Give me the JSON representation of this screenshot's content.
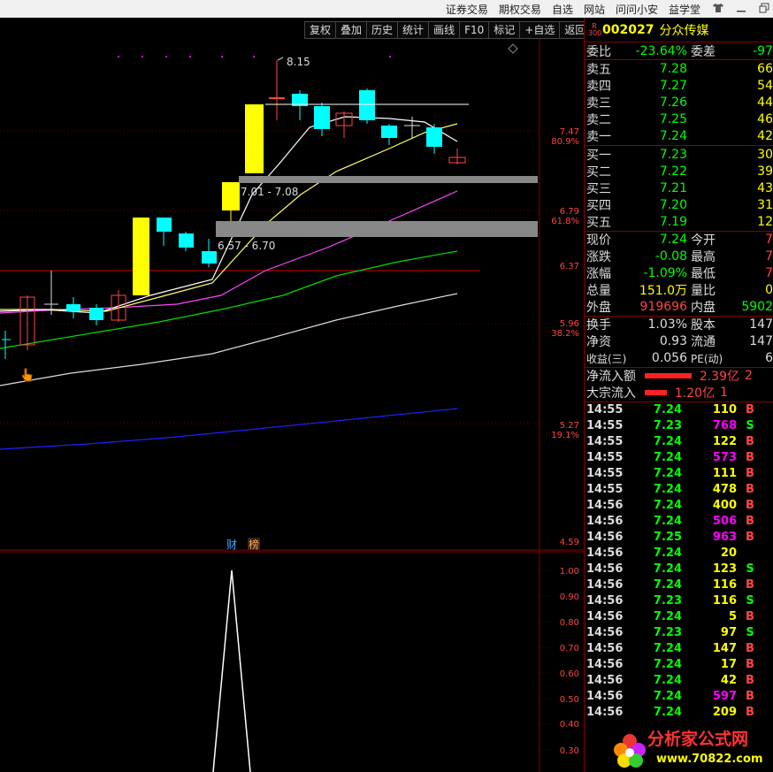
{
  "topnav": {
    "items": [
      "证券交易",
      "期权交易",
      "自选",
      "网站",
      "问问小安",
      "益学堂"
    ],
    "icons": [
      "shirt-icon",
      "minimize-icon",
      "restore-icon"
    ]
  },
  "toolbar": {
    "buttons": [
      "复权",
      "叠加",
      "历史",
      "统计",
      "画线",
      "F10",
      "标记",
      "+自选",
      "返回"
    ]
  },
  "chart": {
    "price_ticks": [
      {
        "label": "7.47",
        "pct": "80.9%"
      },
      {
        "label": "6.79",
        "pct": "61.8%"
      },
      {
        "label": "6.37",
        "pct": ""
      },
      {
        "label": "5.96",
        "pct": "38.2%"
      },
      {
        "label": "5.27",
        "pct": "19.1%"
      },
      {
        "label": "4.59",
        "pct": ""
      }
    ],
    "annotations": {
      "high": "8.15",
      "range1": "7.01 - 7.08",
      "range2": "6.57 - 6.70"
    },
    "markers": {
      "cai": "财",
      "bang": "榜"
    },
    "indicator_ticks": [
      "1.00",
      "0.90",
      "0.80",
      "0.70",
      "0.60",
      "0.50",
      "0.40",
      "0.30"
    ]
  },
  "stock": {
    "badge_top": "R",
    "badge_bottom": "300",
    "code": "002027",
    "name": "分众传媒"
  },
  "ratio": {
    "label": "委比",
    "value": "-23.64%",
    "label2": "委差",
    "value2": "-97"
  },
  "asks": [
    {
      "label": "卖五",
      "price": "7.28",
      "vol": "66"
    },
    {
      "label": "卖四",
      "price": "7.27",
      "vol": "54"
    },
    {
      "label": "卖三",
      "price": "7.26",
      "vol": "44"
    },
    {
      "label": "卖二",
      "price": "7.25",
      "vol": "46"
    },
    {
      "label": "卖一",
      "price": "7.24",
      "vol": "42"
    }
  ],
  "bids": [
    {
      "label": "买一",
      "price": "7.23",
      "vol": "30"
    },
    {
      "label": "买二",
      "price": "7.22",
      "vol": "39"
    },
    {
      "label": "买三",
      "price": "7.21",
      "vol": "43"
    },
    {
      "label": "买四",
      "price": "7.20",
      "vol": "31"
    },
    {
      "label": "买五",
      "price": "7.19",
      "vol": "12"
    }
  ],
  "quote": [
    {
      "l": "现价",
      "v": "7.24",
      "vc": "green",
      "l2": "今开",
      "v2": "7"
    },
    {
      "l": "涨跌",
      "v": "-0.08",
      "vc": "green",
      "l2": "最高",
      "v2": "7"
    },
    {
      "l": "涨幅",
      "v": "-1.09%",
      "vc": "green",
      "l2": "最低",
      "v2": "7"
    },
    {
      "l": "总量",
      "v": "151.0万",
      "vc": "yellow",
      "l2": "量比",
      "v2": "0"
    },
    {
      "l": "外盘",
      "v": "919696",
      "vc": "red",
      "l2": "内盘",
      "v2": "5902"
    }
  ],
  "fundamentals": [
    {
      "l": "换手",
      "v": "1.03%",
      "l2": "股本",
      "v2": "147"
    },
    {
      "l": "净资",
      "v": "0.93",
      "l2": "流通",
      "v2": "147"
    },
    {
      "l": "收益(三)",
      "v": "0.056",
      "l2": "PE(动)",
      "v2": "6"
    }
  ],
  "flows": [
    {
      "label": "净流入额",
      "bar_pct": 0.95,
      "value": "2.39亿",
      "extra": "2"
    },
    {
      "label": "大宗流入",
      "bar_pct": 0.45,
      "value": "1.20亿",
      "extra": "1"
    }
  ],
  "trades": [
    {
      "t": "14:55",
      "p": "7.24",
      "pc": "green",
      "v": "110",
      "vc": "yellow",
      "s": "B"
    },
    {
      "t": "14:55",
      "p": "7.23",
      "pc": "green",
      "v": "768",
      "vc": "purple",
      "s": "S"
    },
    {
      "t": "14:55",
      "p": "7.24",
      "pc": "green",
      "v": "122",
      "vc": "yellow",
      "s": "B"
    },
    {
      "t": "14:55",
      "p": "7.24",
      "pc": "green",
      "v": "573",
      "vc": "purple",
      "s": "B"
    },
    {
      "t": "14:55",
      "p": "7.24",
      "pc": "green",
      "v": "111",
      "vc": "yellow",
      "s": "B"
    },
    {
      "t": "14:55",
      "p": "7.24",
      "pc": "green",
      "v": "478",
      "vc": "yellow",
      "s": "B"
    },
    {
      "t": "14:56",
      "p": "7.24",
      "pc": "green",
      "v": "400",
      "vc": "yellow",
      "s": "B"
    },
    {
      "t": "14:56",
      "p": "7.24",
      "pc": "green",
      "v": "506",
      "vc": "purple",
      "s": "B"
    },
    {
      "t": "14:56",
      "p": "7.25",
      "pc": "green",
      "v": "963",
      "vc": "purple",
      "s": "B"
    },
    {
      "t": "14:56",
      "p": "7.24",
      "pc": "green",
      "v": "20",
      "vc": "yellow",
      "s": ""
    },
    {
      "t": "14:56",
      "p": "7.24",
      "pc": "green",
      "v": "123",
      "vc": "yellow",
      "s": "S"
    },
    {
      "t": "14:56",
      "p": "7.24",
      "pc": "green",
      "v": "116",
      "vc": "yellow",
      "s": "B"
    },
    {
      "t": "14:56",
      "p": "7.23",
      "pc": "green",
      "v": "116",
      "vc": "yellow",
      "s": "S"
    },
    {
      "t": "14:56",
      "p": "7.24",
      "pc": "green",
      "v": "5",
      "vc": "yellow",
      "s": "B"
    },
    {
      "t": "14:56",
      "p": "7.23",
      "pc": "green",
      "v": "97",
      "vc": "yellow",
      "s": "S"
    },
    {
      "t": "14:56",
      "p": "7.24",
      "pc": "green",
      "v": "147",
      "vc": "yellow",
      "s": "B"
    },
    {
      "t": "14:56",
      "p": "7.24",
      "pc": "green",
      "v": "17",
      "vc": "yellow",
      "s": "B"
    },
    {
      "t": "14:56",
      "p": "7.24",
      "pc": "green",
      "v": "42",
      "vc": "yellow",
      "s": "B"
    },
    {
      "t": "14:56",
      "p": "7.24",
      "pc": "green",
      "v": "597",
      "vc": "purple",
      "s": "B"
    },
    {
      "t": "14:56",
      "p": "7.24",
      "pc": "green",
      "v": "209",
      "vc": "yellow",
      "s": "B"
    }
  ],
  "watermark": {
    "title": "分析家公式网",
    "url": "www.70822.com"
  },
  "colors": {
    "up": "#f44",
    "down": "#0ff",
    "yellow_candle": "#ff0",
    "ma5": "#ffffff",
    "ma10": "#ffff66",
    "ma20": "#ff44ff",
    "ma30": "#00dd00",
    "ma60": "#dddddd",
    "ma120": "#2222ff"
  }
}
